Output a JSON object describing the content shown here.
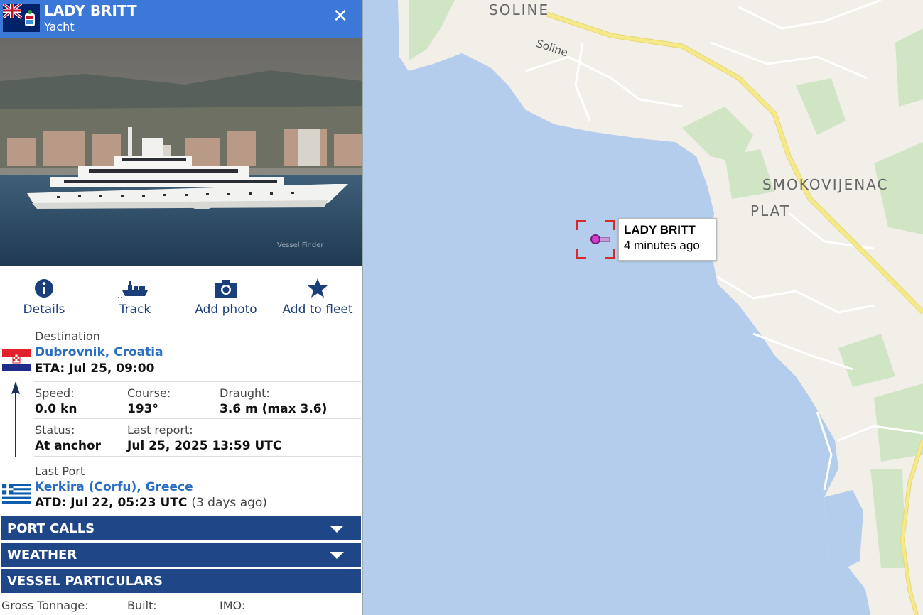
{
  "vessel": {
    "name": "LADY BRITT",
    "type": "Yacht",
    "flag": "cayman-islands-flag"
  },
  "actions": [
    {
      "label": "Details",
      "icon": "info-icon"
    },
    {
      "label": "Track",
      "icon": "ship-track-icon"
    },
    {
      "label": "Add photo",
      "icon": "camera-icon"
    },
    {
      "label": "Add to fleet",
      "icon": "star-icon"
    }
  ],
  "destination": {
    "label": "Destination",
    "port": "Dubrovnik, Croatia",
    "eta": "ETA: Jul 25, 09:00",
    "flag": "croatia-flag"
  },
  "stats": {
    "speed_label": "Speed:",
    "speed": "0.0 kn",
    "course_label": "Course:",
    "course": "193°",
    "draught_label": "Draught:",
    "draught": "3.6 m (max 3.6)",
    "status_label": "Status:",
    "status": "At anchor",
    "last_report_label": "Last report:",
    "last_report": "Jul 25, 2025 13:59 UTC"
  },
  "last_port": {
    "label": "Last Port",
    "port": "Kerkira (Corfu), Greece",
    "atd": "ATD: Jul 22, 05:23 UTC",
    "ago": "(3 days ago)",
    "flag": "greece-flag"
  },
  "sections": [
    "PORT CALLS",
    "WEATHER",
    "VESSEL PARTICULARS"
  ],
  "particulars": {
    "gross_tonnage_label": "Gross Tonnage:",
    "built_label": "Built:",
    "imo_label": "IMO:"
  },
  "photo_watermark": "Vessel Finder",
  "map": {
    "labels": {
      "soline": "SOLINE",
      "soline_road": "Soline",
      "smokovijenac": "SMOKOVIJENAC",
      "plat": "PLAT"
    },
    "tooltip": {
      "name": "LADY BRITT",
      "time": "4 minutes ago"
    },
    "colors": {
      "sea": "#b4cdec",
      "land": "#f2efe9",
      "green": "#cfe5c4",
      "road": "#f6e98a",
      "marker": "#d23fd0"
    }
  }
}
